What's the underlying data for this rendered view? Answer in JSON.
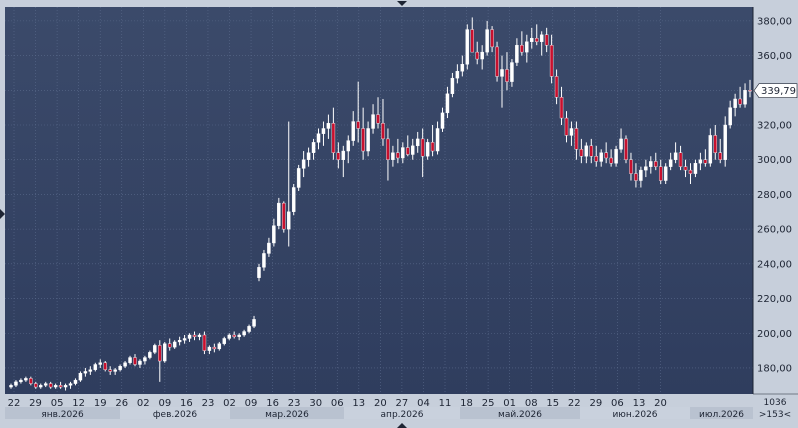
{
  "chart_data": {
    "type": "candlestick",
    "y_ticks": [
      "380,00",
      "360,00",
      "340,00",
      "320,00",
      "300,00",
      "280,00",
      "260,00",
      "240,00",
      "220,00",
      "200,00",
      "180,00"
    ],
    "ylim": [
      165,
      388
    ],
    "last_price": "339,79",
    "x_ticks": [
      "22",
      "29",
      "05",
      "12",
      "19",
      "26",
      "02",
      "09",
      "16",
      "23",
      "02",
      "09",
      "16",
      "23",
      "30",
      "06",
      "13",
      "20",
      "27",
      "04",
      "11",
      "18",
      "25",
      "01",
      "08",
      "15",
      "22",
      "29",
      "06",
      "13",
      "20"
    ],
    "months": [
      "янв.2026",
      "фев.2026",
      "мар.2026",
      "апр.2026",
      "май.2026",
      "июн.2026",
      "июл.2026"
    ],
    "corner_value": "1036",
    "corner_range": ">153<",
    "colors": {
      "background_top": "#3b4a6a",
      "background_bottom": "#2f3d5e",
      "grid": "#5b6b8c",
      "up": "#ffffff",
      "down": "#c8102e",
      "wick": "#ffffff",
      "axis_bg": "#c7cfdb"
    },
    "candles": [
      [
        169.0,
        171.0,
        168.0,
        170.0
      ],
      [
        170.0,
        173.0,
        169.0,
        172.0
      ],
      [
        172.0,
        174.0,
        171.0,
        173.0
      ],
      [
        173.0,
        175.0,
        172.0,
        174.0
      ],
      [
        174.0,
        175.0,
        170.0,
        171.0
      ],
      [
        171.0,
        172.0,
        168.0,
        169.0
      ],
      [
        169.0,
        171.0,
        168.0,
        170.0
      ],
      [
        170.0,
        172.0,
        169.0,
        171.0
      ],
      [
        171.0,
        172.0,
        168.0,
        169.0
      ],
      [
        169.0,
        171.0,
        168.0,
        170.0
      ],
      [
        170.0,
        172.0,
        168.0,
        169.0
      ],
      [
        169.0,
        171.0,
        167.0,
        170.0
      ],
      [
        170.0,
        172.0,
        168.0,
        171.0
      ],
      [
        171.0,
        174.0,
        170.0,
        173.0
      ],
      [
        173.0,
        178.0,
        172.0,
        177.0
      ],
      [
        177.0,
        180.0,
        175.0,
        178.0
      ],
      [
        178.0,
        181.0,
        176.0,
        179.0
      ],
      [
        179.0,
        183.0,
        178.0,
        182.0
      ],
      [
        182.0,
        185.0,
        180.0,
        183.0
      ],
      [
        183.0,
        184.0,
        178.0,
        179.0
      ],
      [
        179.0,
        181.0,
        176.0,
        178.0
      ],
      [
        178.0,
        180.0,
        176.0,
        179.0
      ],
      [
        179.0,
        182.0,
        178.0,
        181.0
      ],
      [
        181.0,
        184.0,
        180.0,
        183.0
      ],
      [
        183.0,
        187.0,
        182.0,
        186.0
      ],
      [
        186.0,
        188.0,
        181.0,
        182.0
      ],
      [
        182.0,
        185.0,
        180.0,
        184.0
      ],
      [
        184.0,
        187.0,
        182.0,
        186.0
      ],
      [
        186.0,
        190.0,
        185.0,
        189.0
      ],
      [
        189.0,
        194.0,
        188.0,
        193.0
      ],
      [
        193.0,
        196.0,
        172.0,
        184.0
      ],
      [
        184.0,
        195.0,
        183.0,
        194.0
      ],
      [
        194.0,
        197.0,
        190.0,
        192.0
      ],
      [
        192.0,
        196.0,
        191.0,
        195.0
      ],
      [
        195.0,
        198.0,
        193.0,
        196.0
      ],
      [
        196.0,
        199.0,
        194.0,
        197.0
      ],
      [
        197.0,
        200.0,
        195.0,
        199.0
      ],
      [
        199.0,
        201.0,
        196.0,
        198.0
      ],
      [
        198.0,
        200.0,
        196.0,
        199.0
      ],
      [
        199.0,
        201.0,
        188.0,
        190.0
      ],
      [
        190.0,
        193.0,
        188.0,
        192.0
      ],
      [
        192.0,
        194.0,
        189.0,
        191.0
      ],
      [
        191.0,
        195.0,
        190.0,
        194.0
      ],
      [
        194.0,
        198.0,
        193.0,
        197.0
      ],
      [
        197.0,
        200.0,
        196.0,
        199.0
      ],
      [
        199.0,
        201.0,
        197.0,
        198.0
      ],
      [
        198.0,
        200.0,
        196.0,
        199.0
      ],
      [
        199.0,
        202.0,
        198.0,
        201.0
      ],
      [
        201.0,
        205.0,
        200.0,
        204.0
      ],
      [
        204.0,
        210.0,
        203.0,
        208.0
      ],
      [
        232.0,
        240.0,
        230.0,
        238.0
      ],
      [
        238.0,
        248.0,
        236.0,
        246.0
      ],
      [
        246.0,
        255.0,
        244.0,
        252.0
      ],
      [
        252.0,
        266.0,
        250.0,
        262.0
      ],
      [
        262.0,
        278.0,
        260.0,
        275.0
      ],
      [
        275.0,
        276.0,
        258.0,
        260.0
      ],
      [
        260.0,
        322.0,
        250.0,
        270.0
      ],
      [
        270.0,
        286.0,
        268.0,
        284.0
      ],
      [
        284.0,
        297.0,
        282.0,
        295.0
      ],
      [
        295.0,
        305.0,
        290.0,
        300.0
      ],
      [
        300.0,
        307.0,
        296.0,
        304.0
      ],
      [
        304.0,
        312.0,
        300.0,
        310.0
      ],
      [
        310.0,
        318.0,
        306.0,
        315.0
      ],
      [
        315.0,
        322.0,
        308.0,
        318.0
      ],
      [
        318.0,
        326.0,
        312.0,
        321.0
      ],
      [
        321.0,
        330.0,
        300.0,
        304.0
      ],
      [
        304.0,
        310.0,
        295.0,
        300.0
      ],
      [
        300.0,
        308.0,
        290.0,
        305.0
      ],
      [
        305.0,
        314.0,
        298.0,
        311.0
      ],
      [
        311.0,
        328.0,
        308.0,
        322.0
      ],
      [
        322.0,
        345.0,
        310.0,
        318.0
      ],
      [
        318.0,
        330.0,
        300.0,
        305.0
      ],
      [
        305.0,
        322.0,
        302.0,
        318.0
      ],
      [
        318.0,
        332.0,
        315.0,
        326.0
      ],
      [
        326.0,
        336.0,
        318.0,
        321.0
      ],
      [
        321.0,
        335.0,
        308.0,
        312.0
      ],
      [
        312.0,
        318.0,
        288.0,
        300.0
      ],
      [
        300.0,
        308.0,
        296.0,
        304.0
      ],
      [
        304.0,
        312.0,
        298.0,
        301.0
      ],
      [
        301.0,
        310.0,
        298.0,
        307.0
      ],
      [
        307.0,
        314.0,
        302.0,
        303.0
      ],
      [
        303.0,
        312.0,
        300.0,
        308.0
      ],
      [
        308.0,
        316.0,
        304.0,
        312.0
      ],
      [
        312.0,
        318.0,
        290.0,
        302.0
      ],
      [
        302.0,
        312.0,
        300.0,
        310.0
      ],
      [
        310.0,
        320.0,
        302.0,
        305.0
      ],
      [
        305.0,
        322.0,
        303.0,
        318.0
      ],
      [
        318.0,
        330.0,
        316.0,
        327.0
      ],
      [
        327.0,
        342.0,
        324.0,
        338.0
      ],
      [
        338.0,
        350.0,
        336.0,
        347.0
      ],
      [
        347.0,
        355.0,
        344.0,
        351.0
      ],
      [
        351.0,
        360.0,
        348.0,
        355.0
      ],
      [
        355.0,
        378.0,
        352.0,
        375.0
      ],
      [
        375.0,
        382.0,
        370.0,
        362.0
      ],
      [
        362.0,
        368.0,
        355.0,
        358.0
      ],
      [
        358.0,
        366.0,
        352.0,
        362.0
      ],
      [
        362.0,
        380.0,
        360.0,
        375.0
      ],
      [
        375.0,
        377.0,
        362.0,
        365.0
      ],
      [
        365.0,
        368.0,
        345.0,
        348.0
      ],
      [
        348.0,
        360.0,
        330.0,
        352.0
      ],
      [
        352.0,
        362.0,
        340.0,
        345.0
      ],
      [
        345.0,
        358.0,
        342.0,
        356.0
      ],
      [
        356.0,
        370.0,
        354.0,
        366.0
      ],
      [
        366.0,
        374.0,
        360.0,
        362.0
      ],
      [
        362.0,
        372.0,
        356.0,
        368.0
      ],
      [
        368.0,
        376.0,
        364.0,
        370.0
      ],
      [
        370.0,
        378.0,
        366.0,
        368.0
      ],
      [
        368.0,
        374.0,
        360.0,
        372.0
      ],
      [
        372.0,
        376.0,
        362.0,
        366.0
      ],
      [
        366.0,
        372.0,
        344.0,
        348.0
      ],
      [
        348.0,
        352.0,
        332.0,
        336.0
      ],
      [
        336.0,
        342.0,
        320.0,
        324.0
      ],
      [
        324.0,
        328.0,
        310.0,
        314.0
      ],
      [
        314.0,
        322.0,
        308.0,
        318.0
      ],
      [
        318.0,
        322.0,
        300.0,
        306.0
      ],
      [
        306.0,
        312.0,
        298.0,
        302.0
      ],
      [
        302.0,
        310.0,
        298.0,
        308.0
      ],
      [
        308.0,
        312.0,
        298.0,
        302.0
      ],
      [
        302.0,
        308.0,
        296.0,
        299.0
      ],
      [
        299.0,
        306.0,
        296.0,
        304.0
      ],
      [
        304.0,
        310.0,
        298.0,
        301.0
      ],
      [
        301.0,
        306.0,
        296.0,
        298.0
      ],
      [
        298.0,
        308.0,
        296.0,
        306.0
      ],
      [
        306.0,
        318.0,
        304.0,
        312.0
      ],
      [
        312.0,
        314.0,
        298.0,
        300.0
      ],
      [
        300.0,
        304.0,
        288.0,
        292.0
      ],
      [
        292.0,
        298.0,
        284.0,
        288.0
      ],
      [
        288.0,
        296.0,
        284.0,
        294.0
      ],
      [
        294.0,
        300.0,
        290.0,
        296.0
      ],
      [
        296.0,
        302.0,
        292.0,
        299.0
      ],
      [
        299.0,
        304.0,
        294.0,
        296.0
      ],
      [
        296.0,
        300.0,
        286.0,
        288.0
      ],
      [
        288.0,
        298.0,
        286.0,
        296.0
      ],
      [
        296.0,
        304.0,
        294.0,
        300.0
      ],
      [
        300.0,
        310.0,
        298.0,
        304.0
      ],
      [
        304.0,
        308.0,
        294.0,
        296.0
      ],
      [
        296.0,
        300.0,
        290.0,
        294.0
      ],
      [
        294.0,
        298.0,
        286.0,
        292.0
      ],
      [
        292.0,
        300.0,
        290.0,
        298.0
      ],
      [
        298.0,
        304.0,
        294.0,
        300.0
      ],
      [
        300.0,
        306.0,
        296.0,
        298.0
      ],
      [
        298.0,
        318.0,
        296.0,
        314.0
      ],
      [
        314.0,
        320.0,
        300.0,
        304.0
      ],
      [
        304.0,
        312.0,
        298.0,
        300.0
      ],
      [
        300.0,
        325.0,
        296.0,
        320.0
      ],
      [
        320.0,
        334.0,
        318.0,
        330.0
      ],
      [
        330.0,
        338.0,
        325.0,
        335.0
      ],
      [
        335.0,
        342.0,
        330.0,
        332.0
      ],
      [
        332.0,
        344.0,
        330.0,
        340.0
      ],
      [
        340.0,
        346.0,
        336.0,
        339.79
      ]
    ]
  }
}
